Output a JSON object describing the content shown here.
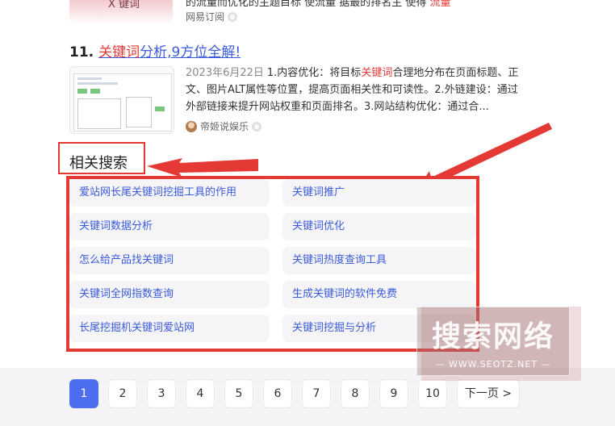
{
  "top_result": {
    "thumb_caption": "X 键词",
    "snippet_visible": "的流量而优化的主题目标 使流量 据最的排名主 使得",
    "highlight_word": "流量",
    "source": "网易订阅"
  },
  "result_11": {
    "number": "11.",
    "title_highlight": "关键词",
    "title_rest": "分析,9方位全解!",
    "date": "2023年6月22日",
    "snippet_pre": "1.内容优化：将目标",
    "snippet_hl": "关键词",
    "snippet_post": "合理地分布在页面标题、正文、图片ALT属性等位置，提高页面相关性和可读性。2.外链建设：通过外部链接来提升网站权重和页面排名。3.网站结构优化：通过合...",
    "source": "帝姬说娱乐"
  },
  "related": {
    "title": "相关搜索",
    "items": [
      "爱站网长尾关键词挖掘工具的作用",
      "关键词推广",
      "关键词数据分析",
      "关键词优化",
      "怎么给产品找关键词",
      "关键词热度查询工具",
      "关键词全网指数查询",
      "生成关键词的软件免费",
      "长尾挖掘机关键词爱站网",
      "关键词挖掘与分析"
    ]
  },
  "pagination": {
    "pages": [
      "1",
      "2",
      "3",
      "4",
      "5",
      "6",
      "7",
      "8",
      "9",
      "10"
    ],
    "active": "1",
    "next_label": "下一页 >"
  },
  "watermark": {
    "text": "搜索网络",
    "url": "WWW.SEOTZ.NET"
  },
  "colors": {
    "link": "#3b5bdb",
    "highlight": "#e53935",
    "annotation": "#e53935",
    "active_page": "#4e6ef2"
  }
}
